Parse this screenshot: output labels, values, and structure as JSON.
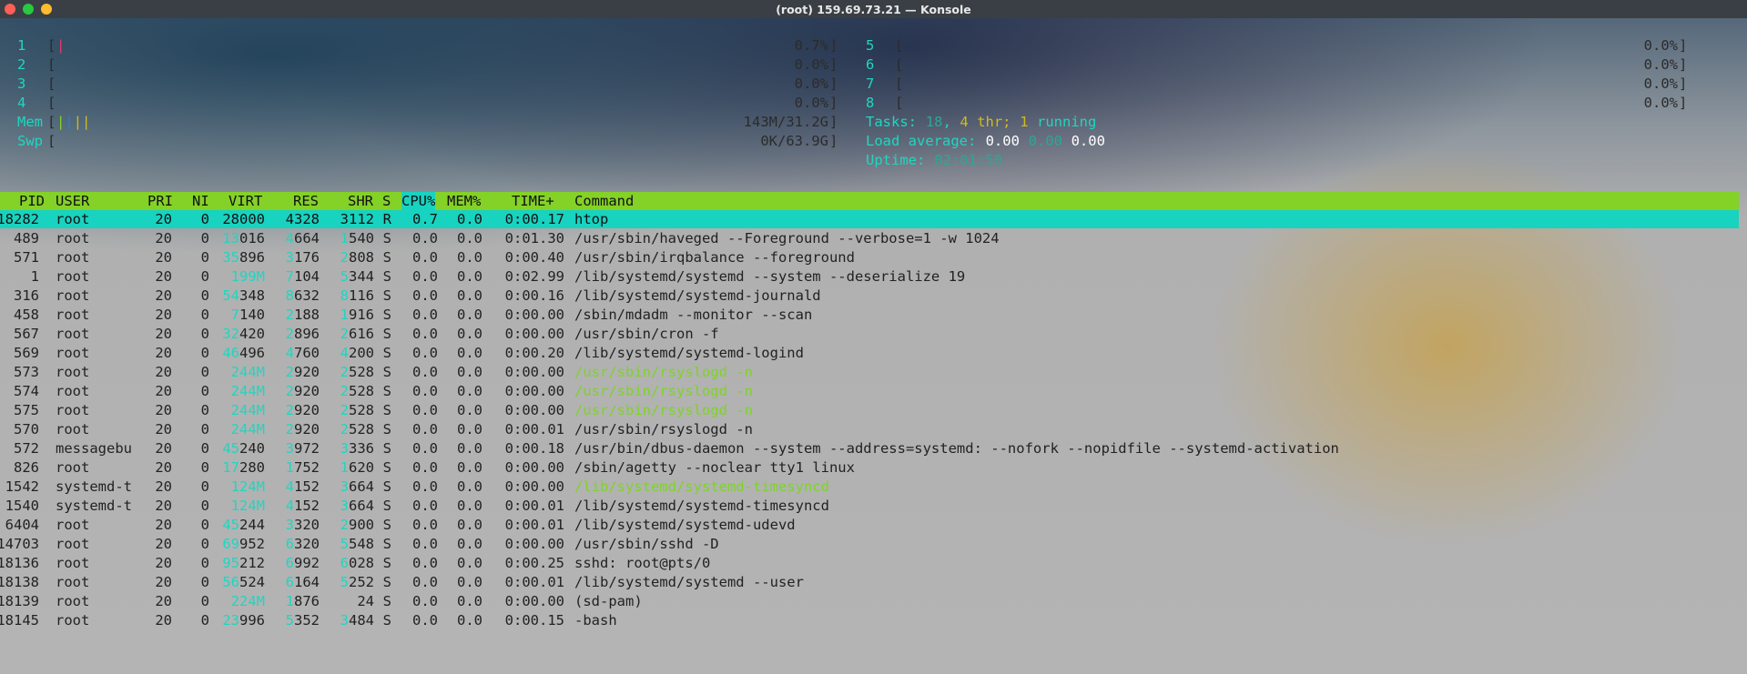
{
  "window": {
    "title": "(root) 159.69.73.21 — Konsole"
  },
  "cpus_left": [
    {
      "num": "1",
      "bar": "|",
      "pct": "0.7%"
    },
    {
      "num": "2",
      "bar": "",
      "pct": "0.0%"
    },
    {
      "num": "3",
      "bar": "",
      "pct": "0.0%"
    },
    {
      "num": "4",
      "bar": "",
      "pct": "0.0%"
    }
  ],
  "cpus_right": [
    {
      "num": "5",
      "bar": "",
      "pct": "0.0%"
    },
    {
      "num": "6",
      "bar": "",
      "pct": "0.0%"
    },
    {
      "num": "7",
      "bar": "",
      "pct": "0.0%"
    },
    {
      "num": "8",
      "bar": "",
      "pct": "0.0%"
    }
  ],
  "mem": {
    "label": "Mem",
    "bar": "||||",
    "value": "143M/31.2G"
  },
  "swp": {
    "label": "Swp",
    "bar": "",
    "value": "0K/63.9G"
  },
  "tasks": {
    "label": "Tasks:",
    "count": "18",
    "sep": ",",
    "thr": "4",
    "thr_label": "thr;",
    "running": "1",
    "running_label": "running"
  },
  "load": {
    "label": "Load average:",
    "v1": "0.00",
    "v2": "0.00",
    "v3": "0.00"
  },
  "uptime": {
    "label": "Uptime:",
    "value": "02:01:50"
  },
  "columns": [
    "PID",
    "USER",
    "PRI",
    "NI",
    "VIRT",
    "RES",
    "SHR",
    "S",
    "CPU%",
    "MEM%",
    "TIME+",
    "Command"
  ],
  "processes": [
    {
      "pid": "18282",
      "user": "root",
      "pri": "20",
      "ni": "0",
      "virt": "28000",
      "res": "4328",
      "shr": "3112",
      "s": "R",
      "cpu": "0.7",
      "mem": "0.0",
      "time": "0:00.17",
      "cmd": "htop"
    },
    {
      "pid": "489",
      "user": "root",
      "pri": "20",
      "ni": "0",
      "virt": "13016",
      "res": "4664",
      "shr": "1540",
      "s": "S",
      "cpu": "0.0",
      "mem": "0.0",
      "time": "0:01.30",
      "cmd": "/usr/sbin/haveged --Foreground --verbose=1 -w 1024"
    },
    {
      "pid": "571",
      "user": "root",
      "pri": "20",
      "ni": "0",
      "virt": "35896",
      "res": "3176",
      "shr": "2808",
      "s": "S",
      "cpu": "0.0",
      "mem": "0.0",
      "time": "0:00.40",
      "cmd": "/usr/sbin/irqbalance --foreground"
    },
    {
      "pid": "1",
      "user": "root",
      "pri": "20",
      "ni": "0",
      "virt": "199M",
      "res": "7104",
      "shr": "5344",
      "s": "S",
      "cpu": "0.0",
      "mem": "0.0",
      "time": "0:02.99",
      "cmd": "/lib/systemd/systemd --system --deserialize 19"
    },
    {
      "pid": "316",
      "user": "root",
      "pri": "20",
      "ni": "0",
      "virt": "54348",
      "res": "8632",
      "shr": "8116",
      "s": "S",
      "cpu": "0.0",
      "mem": "0.0",
      "time": "0:00.16",
      "cmd": "/lib/systemd/systemd-journald"
    },
    {
      "pid": "458",
      "user": "root",
      "pri": "20",
      "ni": "0",
      "virt": "7140",
      "res": "2188",
      "shr": "1916",
      "s": "S",
      "cpu": "0.0",
      "mem": "0.0",
      "time": "0:00.00",
      "cmd": "/sbin/mdadm --monitor --scan"
    },
    {
      "pid": "567",
      "user": "root",
      "pri": "20",
      "ni": "0",
      "virt": "32420",
      "res": "2896",
      "shr": "2616",
      "s": "S",
      "cpu": "0.0",
      "mem": "0.0",
      "time": "0:00.00",
      "cmd": "/usr/sbin/cron -f"
    },
    {
      "pid": "569",
      "user": "root",
      "pri": "20",
      "ni": "0",
      "virt": "46496",
      "res": "4760",
      "shr": "4200",
      "s": "S",
      "cpu": "0.0",
      "mem": "0.0",
      "time": "0:00.20",
      "cmd": "/lib/systemd/systemd-logind"
    },
    {
      "pid": "573",
      "user": "root",
      "pri": "20",
      "ni": "0",
      "virt": "244M",
      "res": "2920",
      "shr": "2528",
      "s": "S",
      "cpu": "0.0",
      "mem": "0.0",
      "time": "0:00.00",
      "cmd": "/usr/sbin/rsyslogd -n",
      "thread": true
    },
    {
      "pid": "574",
      "user": "root",
      "pri": "20",
      "ni": "0",
      "virt": "244M",
      "res": "2920",
      "shr": "2528",
      "s": "S",
      "cpu": "0.0",
      "mem": "0.0",
      "time": "0:00.00",
      "cmd": "/usr/sbin/rsyslogd -n",
      "thread": true
    },
    {
      "pid": "575",
      "user": "root",
      "pri": "20",
      "ni": "0",
      "virt": "244M",
      "res": "2920",
      "shr": "2528",
      "s": "S",
      "cpu": "0.0",
      "mem": "0.0",
      "time": "0:00.00",
      "cmd": "/usr/sbin/rsyslogd -n",
      "thread": true
    },
    {
      "pid": "570",
      "user": "root",
      "pri": "20",
      "ni": "0",
      "virt": "244M",
      "res": "2920",
      "shr": "2528",
      "s": "S",
      "cpu": "0.0",
      "mem": "0.0",
      "time": "0:00.01",
      "cmd": "/usr/sbin/rsyslogd -n"
    },
    {
      "pid": "572",
      "user": "messagebu",
      "pri": "20",
      "ni": "0",
      "virt": "45240",
      "res": "3972",
      "shr": "3336",
      "s": "S",
      "cpu": "0.0",
      "mem": "0.0",
      "time": "0:00.18",
      "cmd": "/usr/bin/dbus-daemon --system --address=systemd: --nofork --nopidfile --systemd-activation"
    },
    {
      "pid": "826",
      "user": "root",
      "pri": "20",
      "ni": "0",
      "virt": "17280",
      "res": "1752",
      "shr": "1620",
      "s": "S",
      "cpu": "0.0",
      "mem": "0.0",
      "time": "0:00.00",
      "cmd": "/sbin/agetty --noclear tty1 linux"
    },
    {
      "pid": "1542",
      "user": "systemd-t",
      "pri": "20",
      "ni": "0",
      "virt": "124M",
      "res": "4152",
      "shr": "3664",
      "s": "S",
      "cpu": "0.0",
      "mem": "0.0",
      "time": "0:00.00",
      "cmd": "/lib/systemd/systemd-timesyncd",
      "thread": true
    },
    {
      "pid": "1540",
      "user": "systemd-t",
      "pri": "20",
      "ni": "0",
      "virt": "124M",
      "res": "4152",
      "shr": "3664",
      "s": "S",
      "cpu": "0.0",
      "mem": "0.0",
      "time": "0:00.01",
      "cmd": "/lib/systemd/systemd-timesyncd"
    },
    {
      "pid": "6404",
      "user": "root",
      "pri": "20",
      "ni": "0",
      "virt": "45244",
      "res": "3320",
      "shr": "2900",
      "s": "S",
      "cpu": "0.0",
      "mem": "0.0",
      "time": "0:00.01",
      "cmd": "/lib/systemd/systemd-udevd"
    },
    {
      "pid": "14703",
      "user": "root",
      "pri": "20",
      "ni": "0",
      "virt": "69952",
      "res": "6320",
      "shr": "5548",
      "s": "S",
      "cpu": "0.0",
      "mem": "0.0",
      "time": "0:00.00",
      "cmd": "/usr/sbin/sshd -D"
    },
    {
      "pid": "18136",
      "user": "root",
      "pri": "20",
      "ni": "0",
      "virt": "95212",
      "res": "6992",
      "shr": "6028",
      "s": "S",
      "cpu": "0.0",
      "mem": "0.0",
      "time": "0:00.25",
      "cmd": "sshd: root@pts/0"
    },
    {
      "pid": "18138",
      "user": "root",
      "pri": "20",
      "ni": "0",
      "virt": "56524",
      "res": "6164",
      "shr": "5252",
      "s": "S",
      "cpu": "0.0",
      "mem": "0.0",
      "time": "0:00.01",
      "cmd": "/lib/systemd/systemd --user"
    },
    {
      "pid": "18139",
      "user": "root",
      "pri": "20",
      "ni": "0",
      "virt": "224M",
      "res": "1876",
      "shr": "24",
      "s": "S",
      "cpu": "0.0",
      "mem": "0.0",
      "time": "0:00.00",
      "cmd": "(sd-pam)"
    },
    {
      "pid": "18145",
      "user": "root",
      "pri": "20",
      "ni": "0",
      "virt": "23996",
      "res": "5352",
      "shr": "3484",
      "s": "S",
      "cpu": "0.0",
      "mem": "0.0",
      "time": "0:00.15",
      "cmd": "-bash"
    }
  ]
}
